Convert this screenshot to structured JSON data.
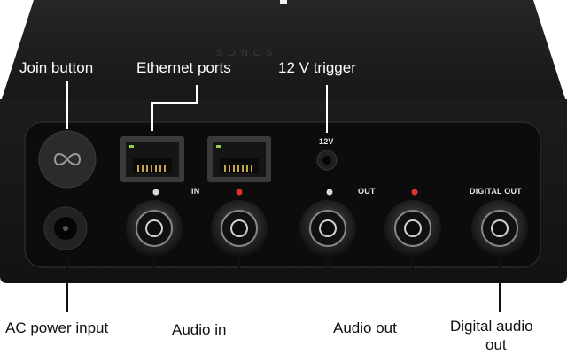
{
  "brand": "SONOS",
  "callouts": {
    "join_button": "Join button",
    "ethernet_ports": "Ethernet ports",
    "trigger_12v": "12 V trigger",
    "ac_power_input": "AC power input",
    "audio_in": "Audio in",
    "audio_out": "Audio out",
    "digital_audio_out_line1": "Digital audio",
    "digital_audio_out_line2": "out"
  },
  "panel_labels": {
    "trigger": "12V",
    "in": "IN",
    "out": "OUT",
    "digital_out": "DIGITAL OUT"
  },
  "colors": {
    "device_body": "#1b1b1b",
    "panel": "#0e0e0e",
    "indicator_left": "#d9d9d9",
    "indicator_right": "#e0312b",
    "callout_line_light": "#ffffff",
    "callout_line_dark": "#111111"
  },
  "icons": {
    "join_button_symbol": "infinity-icon"
  }
}
